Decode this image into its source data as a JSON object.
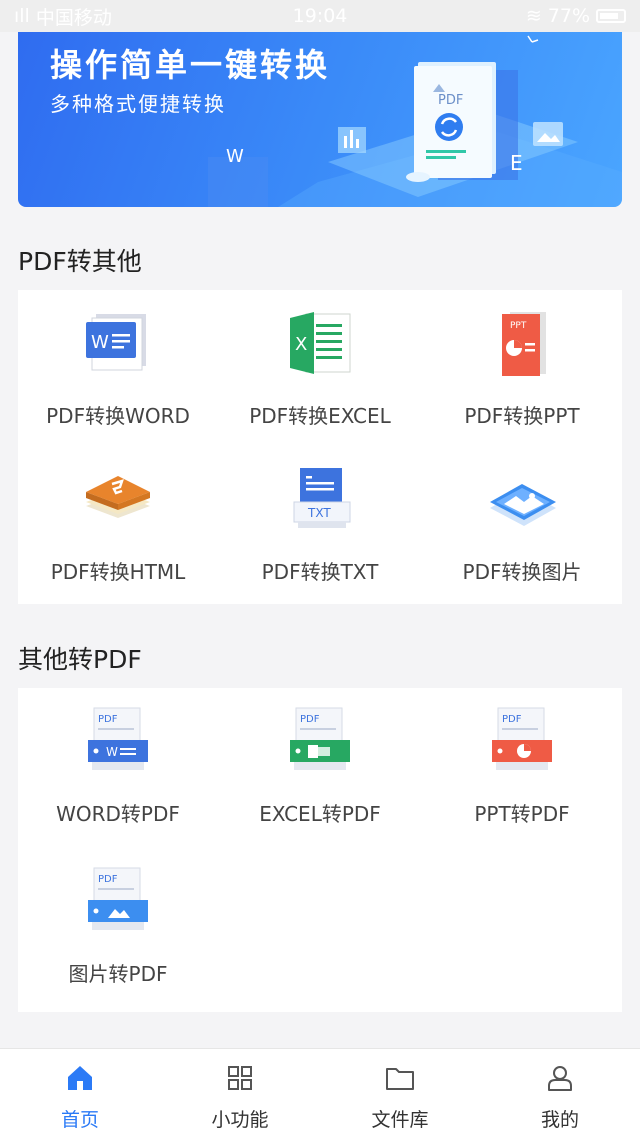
{
  "status_bar": {
    "carrier": "中国移动",
    "time": "19:04",
    "battery": "77%"
  },
  "banner": {
    "title": "操作简单一键转换",
    "subtitle": "多种格式便捷转换",
    "doc_label": "PDF",
    "letter_w": "W",
    "letter_e": "E"
  },
  "section1": {
    "title": "PDF转其他",
    "items": [
      {
        "label": "PDF转换WORD",
        "icon": "word-doc-icon"
      },
      {
        "label": "PDF转换EXCEL",
        "icon": "excel-doc-icon"
      },
      {
        "label": "PDF转换PPT",
        "icon": "ppt-doc-icon"
      },
      {
        "label": "PDF转换HTML",
        "icon": "html-doc-icon"
      },
      {
        "label": "PDF转换TXT",
        "icon": "txt-doc-icon"
      },
      {
        "label": "PDF转换图片",
        "icon": "image-doc-icon"
      }
    ]
  },
  "section2": {
    "title": "其他转PDF",
    "items": [
      {
        "label": "WORD转PDF",
        "icon": "word-to-pdf-icon"
      },
      {
        "label": "EXCEL转PDF",
        "icon": "excel-to-pdf-icon"
      },
      {
        "label": "PPT转PDF",
        "icon": "ppt-to-pdf-icon"
      },
      {
        "label": "图片转PDF",
        "icon": "image-to-pdf-icon"
      }
    ]
  },
  "icon_text": {
    "ppt": "PPT",
    "txt": "TXT",
    "pdf": "PDF",
    "w": "W",
    "x": "X"
  },
  "tabbar": {
    "tabs": [
      {
        "label": "首页",
        "icon": "home-icon",
        "active": true
      },
      {
        "label": "小功能",
        "icon": "grid-icon",
        "active": false
      },
      {
        "label": "文件库",
        "icon": "folder-icon",
        "active": false
      },
      {
        "label": "我的",
        "icon": "user-icon",
        "active": false
      }
    ]
  },
  "colors": {
    "accent": "#2b7af6",
    "word": "#3d73de",
    "excel": "#27a862",
    "ppt": "#ef5b45",
    "html": "#e8842c",
    "image": "#3c8ef0"
  }
}
